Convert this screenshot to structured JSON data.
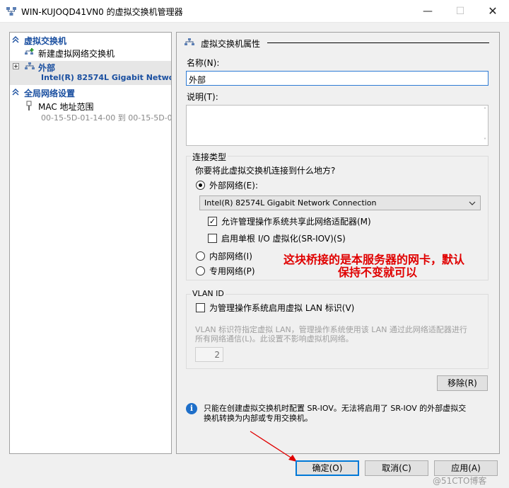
{
  "window": {
    "title": "WIN-KUJOQD41VN0 的虚拟交换机管理器",
    "minimize": "—",
    "maximize": "☐",
    "close": "✕"
  },
  "tree": {
    "section_switches": "虚拟交换机",
    "new_switch": "新建虚拟网络交换机",
    "external_name": "外部",
    "external_adapter": "Intel(R) 82574L Gigabit Netwo...",
    "section_global": "全局网络设置",
    "mac_label": "MAC 地址范围",
    "mac_range": "00-15-5D-01-14-00 到 00-15-5D-0..."
  },
  "props": {
    "header": "虚拟交换机属性",
    "name_label": "名称(N):",
    "name_value": "外部",
    "desc_label": "说明(T):",
    "desc_value": "",
    "conn_type_label": "连接类型",
    "conn_question": "你要将此虚拟交换机连接到什么地方?",
    "external_label": "外部网络(E):",
    "adapter_selected": "Intel(R) 82574L Gigabit Network Connection",
    "allow_mgmt": "允许管理操作系统共享此网络适配器(M)",
    "sriov": "启用单根 I/O 虚拟化(SR-IOV)(S)",
    "internal_label": "内部网络(I)",
    "private_label": "专用网络(P)",
    "vlan_title": "VLAN ID",
    "vlan_enable": "为管理操作系统启用虚拟 LAN 标识(V)",
    "vlan_desc_1": "VLAN 标识符指定虚拟 LAN，管理操作系统使用该 LAN 通过此网络适配器进行",
    "vlan_desc_2": "所有网络通信(L)。此设置不影响虚拟机网络。",
    "vlan_value": "2",
    "remove_button": "移除(R)",
    "info_1": "只能在创建虚拟交换机时配置 SR-IOV。无法将启用了 SR-IOV 的外部虚拟交",
    "info_2": "换机转换为内部或专用交换机。"
  },
  "annotation": {
    "line1": "这块桥接的是本服务器的网卡，默认",
    "line2": "保持不变就可以"
  },
  "buttons": {
    "ok": "确定(O)",
    "cancel": "取消(C)",
    "apply": "应用(A)"
  },
  "watermark": "@51CTO博客",
  "colors": {
    "accent": "#0078d7",
    "tree_section": "#1a4fa0",
    "annotation": "#e00000"
  }
}
